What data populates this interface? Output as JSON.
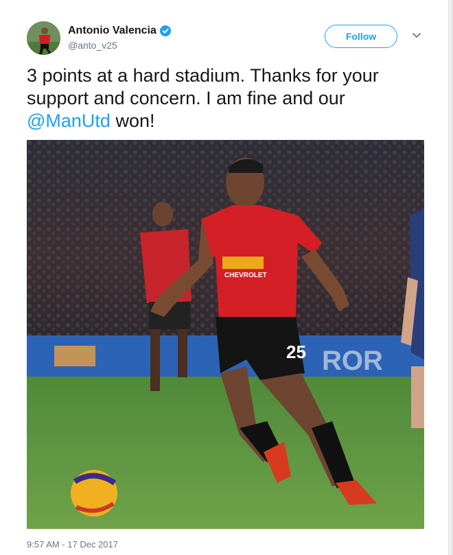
{
  "account": {
    "display_name": "Antonio Valencia",
    "handle": "@anto_v25",
    "verified": true,
    "avatar_icon": "profile-photo"
  },
  "actions": {
    "follow_label": "Follow",
    "menu_icon": "chevron-down-icon"
  },
  "tweet": {
    "text_part1": "3 points at a hard stadium. Thanks for your support and concern. I am fine and our ",
    "mention": "@ManUtd",
    "text_part2": " won!",
    "photo_shirt_sponsor": "CHEVROLET",
    "photo_shirt_number": "25"
  },
  "footer": {
    "timestamp": "9:57 AM - 17 Dec 2017"
  },
  "colors": {
    "accent": "#1da1f2",
    "text": "#14171a",
    "muted": "#657786"
  }
}
